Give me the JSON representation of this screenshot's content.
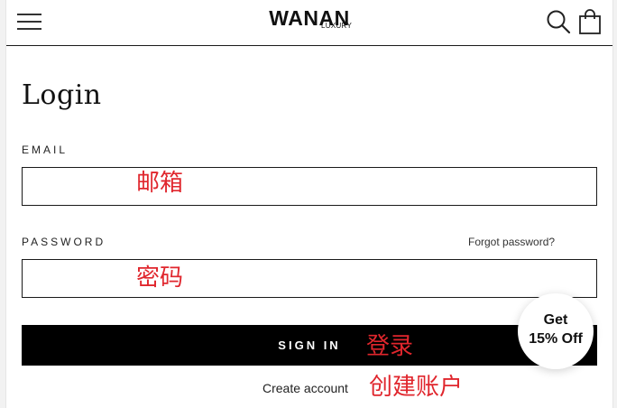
{
  "header": {
    "menu_icon": "hamburger-menu-icon",
    "logo_main": "WANAN",
    "logo_sub": "LUXURY",
    "search_icon": "search-icon",
    "cart_icon": "shopping-bag-icon"
  },
  "form": {
    "title": "Login",
    "email_label": "EMAIL",
    "email_value": "",
    "email_note": "邮箱",
    "password_label": "PASSWORD",
    "password_value": "",
    "password_note": "密码",
    "forgot_link": "Forgot password?",
    "signin_label": "SIGN IN",
    "signin_note": "登录",
    "create_link": "Create account",
    "create_note": "创建账户"
  },
  "promo": {
    "line1": "Get",
    "line2": "15% Off"
  },
  "colors": {
    "annotation": "#e0262d",
    "button_bg": "#000000",
    "border": "#1a1a1a"
  }
}
